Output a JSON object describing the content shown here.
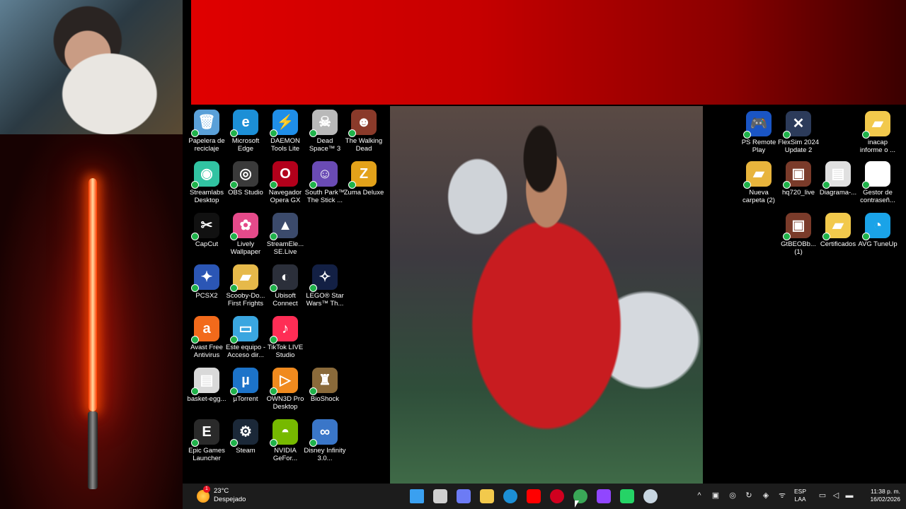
{
  "desktop": {
    "left_icons": [
      {
        "label": "Papelera de reciclaje",
        "icon": "recycle-bin-icon",
        "color": "#5aa0d8",
        "symbol": "🗑"
      },
      {
        "label": "Microsoft Edge",
        "icon": "edge-icon",
        "color": "#1c8fd6",
        "symbol": "e"
      },
      {
        "label": "DAEMON Tools Lite",
        "icon": "daemon-tools-icon",
        "color": "#1f8ee8",
        "symbol": "⚡"
      },
      {
        "label": "Dead Space™ 3",
        "icon": "dead-space-icon",
        "color": "#b9b9b9",
        "symbol": "☠"
      },
      {
        "label": "The Walking Dead",
        "icon": "walking-dead-icon",
        "color": "#8a3a2a",
        "symbol": "☻"
      },
      {
        "label": "Streamlabs Desktop",
        "icon": "streamlabs-icon",
        "color": "#31c3a2",
        "symbol": "◉"
      },
      {
        "label": "OBS Studio",
        "icon": "obs-icon",
        "color": "#3a3a3a",
        "symbol": "◎"
      },
      {
        "label": "Navegador Opera GX",
        "icon": "opera-gx-icon",
        "color": "#b3001b",
        "symbol": "O"
      },
      {
        "label": "South Park™ The Stick ...",
        "icon": "south-park-icon",
        "color": "#6a4bb5",
        "symbol": "☺"
      },
      {
        "label": "Zuma Deluxe",
        "icon": "zuma-icon",
        "color": "#e3a21a",
        "symbol": "Z"
      },
      {
        "label": "CapCut",
        "icon": "capcut-icon",
        "color": "#111111",
        "symbol": "✂"
      },
      {
        "label": "Lively Wallpaper",
        "icon": "lively-icon",
        "color": "#e54a8a",
        "symbol": "✿"
      },
      {
        "label": "StreamEle... SE.Live",
        "icon": "streamelements-icon",
        "color": "#3b4a6b",
        "symbol": "▲"
      },
      {
        "label": "PCSX2",
        "icon": "pcsx2-icon",
        "color": "#2b56b5",
        "symbol": "✦"
      },
      {
        "label": "Scooby-Do... First Frights",
        "icon": "scooby-folder-icon",
        "color": "#e6b94a",
        "symbol": "▰"
      },
      {
        "label": "Ubisoft Connect",
        "icon": "ubisoft-icon",
        "color": "#2b2f3a",
        "symbol": "◐"
      },
      {
        "label": "LEGO® Star Wars™ Th...",
        "icon": "lego-starwars-icon",
        "color": "#132044",
        "symbol": "✧"
      },
      {
        "label": "Avast Free Antivirus",
        "icon": "avast-icon",
        "color": "#f26a1b",
        "symbol": "a"
      },
      {
        "label": "Este equipo - Acceso dir...",
        "icon": "this-pc-icon",
        "color": "#3aa6e0",
        "symbol": "▭"
      },
      {
        "label": "TikTok LIVE Studio",
        "icon": "tiktok-live-icon",
        "color": "#ff2d55",
        "symbol": "♪"
      },
      {
        "label": "basket-egg...",
        "icon": "file-icon",
        "color": "#d9d9d9",
        "symbol": "▤"
      },
      {
        "label": "µTorrent",
        "icon": "utorrent-icon",
        "color": "#1c73c9",
        "symbol": "µ"
      },
      {
        "label": "OWN3D Pro Desktop",
        "icon": "own3d-icon",
        "color": "#f08a1e",
        "symbol": "▷"
      },
      {
        "label": "BioShock",
        "icon": "bioshock-icon",
        "color": "#8a6a3a",
        "symbol": "♜"
      },
      {
        "label": "Epic Games Launcher",
        "icon": "epic-games-icon",
        "color": "#2a2a2a",
        "symbol": "E"
      },
      {
        "label": "Steam",
        "icon": "steam-icon",
        "color": "#1b2838",
        "symbol": "⚙"
      },
      {
        "label": "NVIDIA GeFor...",
        "icon": "nvidia-icon",
        "color": "#76b900",
        "symbol": "◓"
      },
      {
        "label": "Disney Infinity 3.0...",
        "icon": "disney-infinity-icon",
        "color": "#3a76c8",
        "symbol": "∞"
      }
    ],
    "right_icons": [
      {
        "label": "PS Remote Play",
        "icon": "ps-remote-play-icon",
        "color": "#1a55c4",
        "symbol": "🎮"
      },
      {
        "label": "FlexSim 2024 Update 2",
        "icon": "flexsim-icon",
        "color": "#2c3b5a",
        "symbol": "✕"
      },
      {
        "label": "inacap informe o ...",
        "icon": "folder-icon",
        "color": "#f2c94c",
        "symbol": "▰"
      },
      {
        "label": "Nueva carpeta (2)",
        "icon": "folder-icon",
        "color": "#e8b43c",
        "symbol": "▰"
      },
      {
        "label": "hq720_live",
        "icon": "image-icon",
        "color": "#7a3b2a",
        "symbol": "▣"
      },
      {
        "label": "Diagrama-...",
        "icon": "document-icon",
        "color": "#e0e0e0",
        "symbol": "▤"
      },
      {
        "label": "Gestor de contraseñ...",
        "icon": "password-manager-icon",
        "color": "#ffffff",
        "symbol": "●"
      },
      {
        "label": "GtBEOBb... (1)",
        "icon": "image-icon",
        "color": "#7a3b2a",
        "symbol": "▣"
      },
      {
        "label": "Certificados",
        "icon": "folder-icon",
        "color": "#f2c94c",
        "symbol": "▰"
      },
      {
        "label": "AVG TuneUp",
        "icon": "avg-tuneup-icon",
        "color": "#1aa3e8",
        "symbol": "◔"
      }
    ]
  },
  "taskbar": {
    "weather": {
      "temp": "23°C",
      "condition": "Despejado",
      "badge": "1"
    },
    "apps": [
      {
        "name": "windows-start-icon",
        "color": "#3aa0f0"
      },
      {
        "name": "task-view-icon",
        "color": "#cfcfcf"
      },
      {
        "name": "copilot-icon",
        "color": "#6c7bf5"
      },
      {
        "name": "file-explorer-icon",
        "color": "#f2c94c"
      },
      {
        "name": "edge-icon",
        "color": "#1c8fd6"
      },
      {
        "name": "youtube-icon",
        "color": "#ff0000"
      },
      {
        "name": "opera-gx-icon",
        "color": "#d1001f"
      },
      {
        "name": "chrome-icon",
        "color": "#3aa757"
      },
      {
        "name": "twitch-icon",
        "color": "#9146ff"
      },
      {
        "name": "whatsapp-icon",
        "color": "#25d366"
      },
      {
        "name": "steam-icon",
        "color": "#c7d5e0"
      }
    ],
    "language": {
      "line1": "ESP",
      "line2": "LAA"
    },
    "clock": {
      "time": "11:38 p. m.",
      "date": "16/02/2026"
    }
  }
}
